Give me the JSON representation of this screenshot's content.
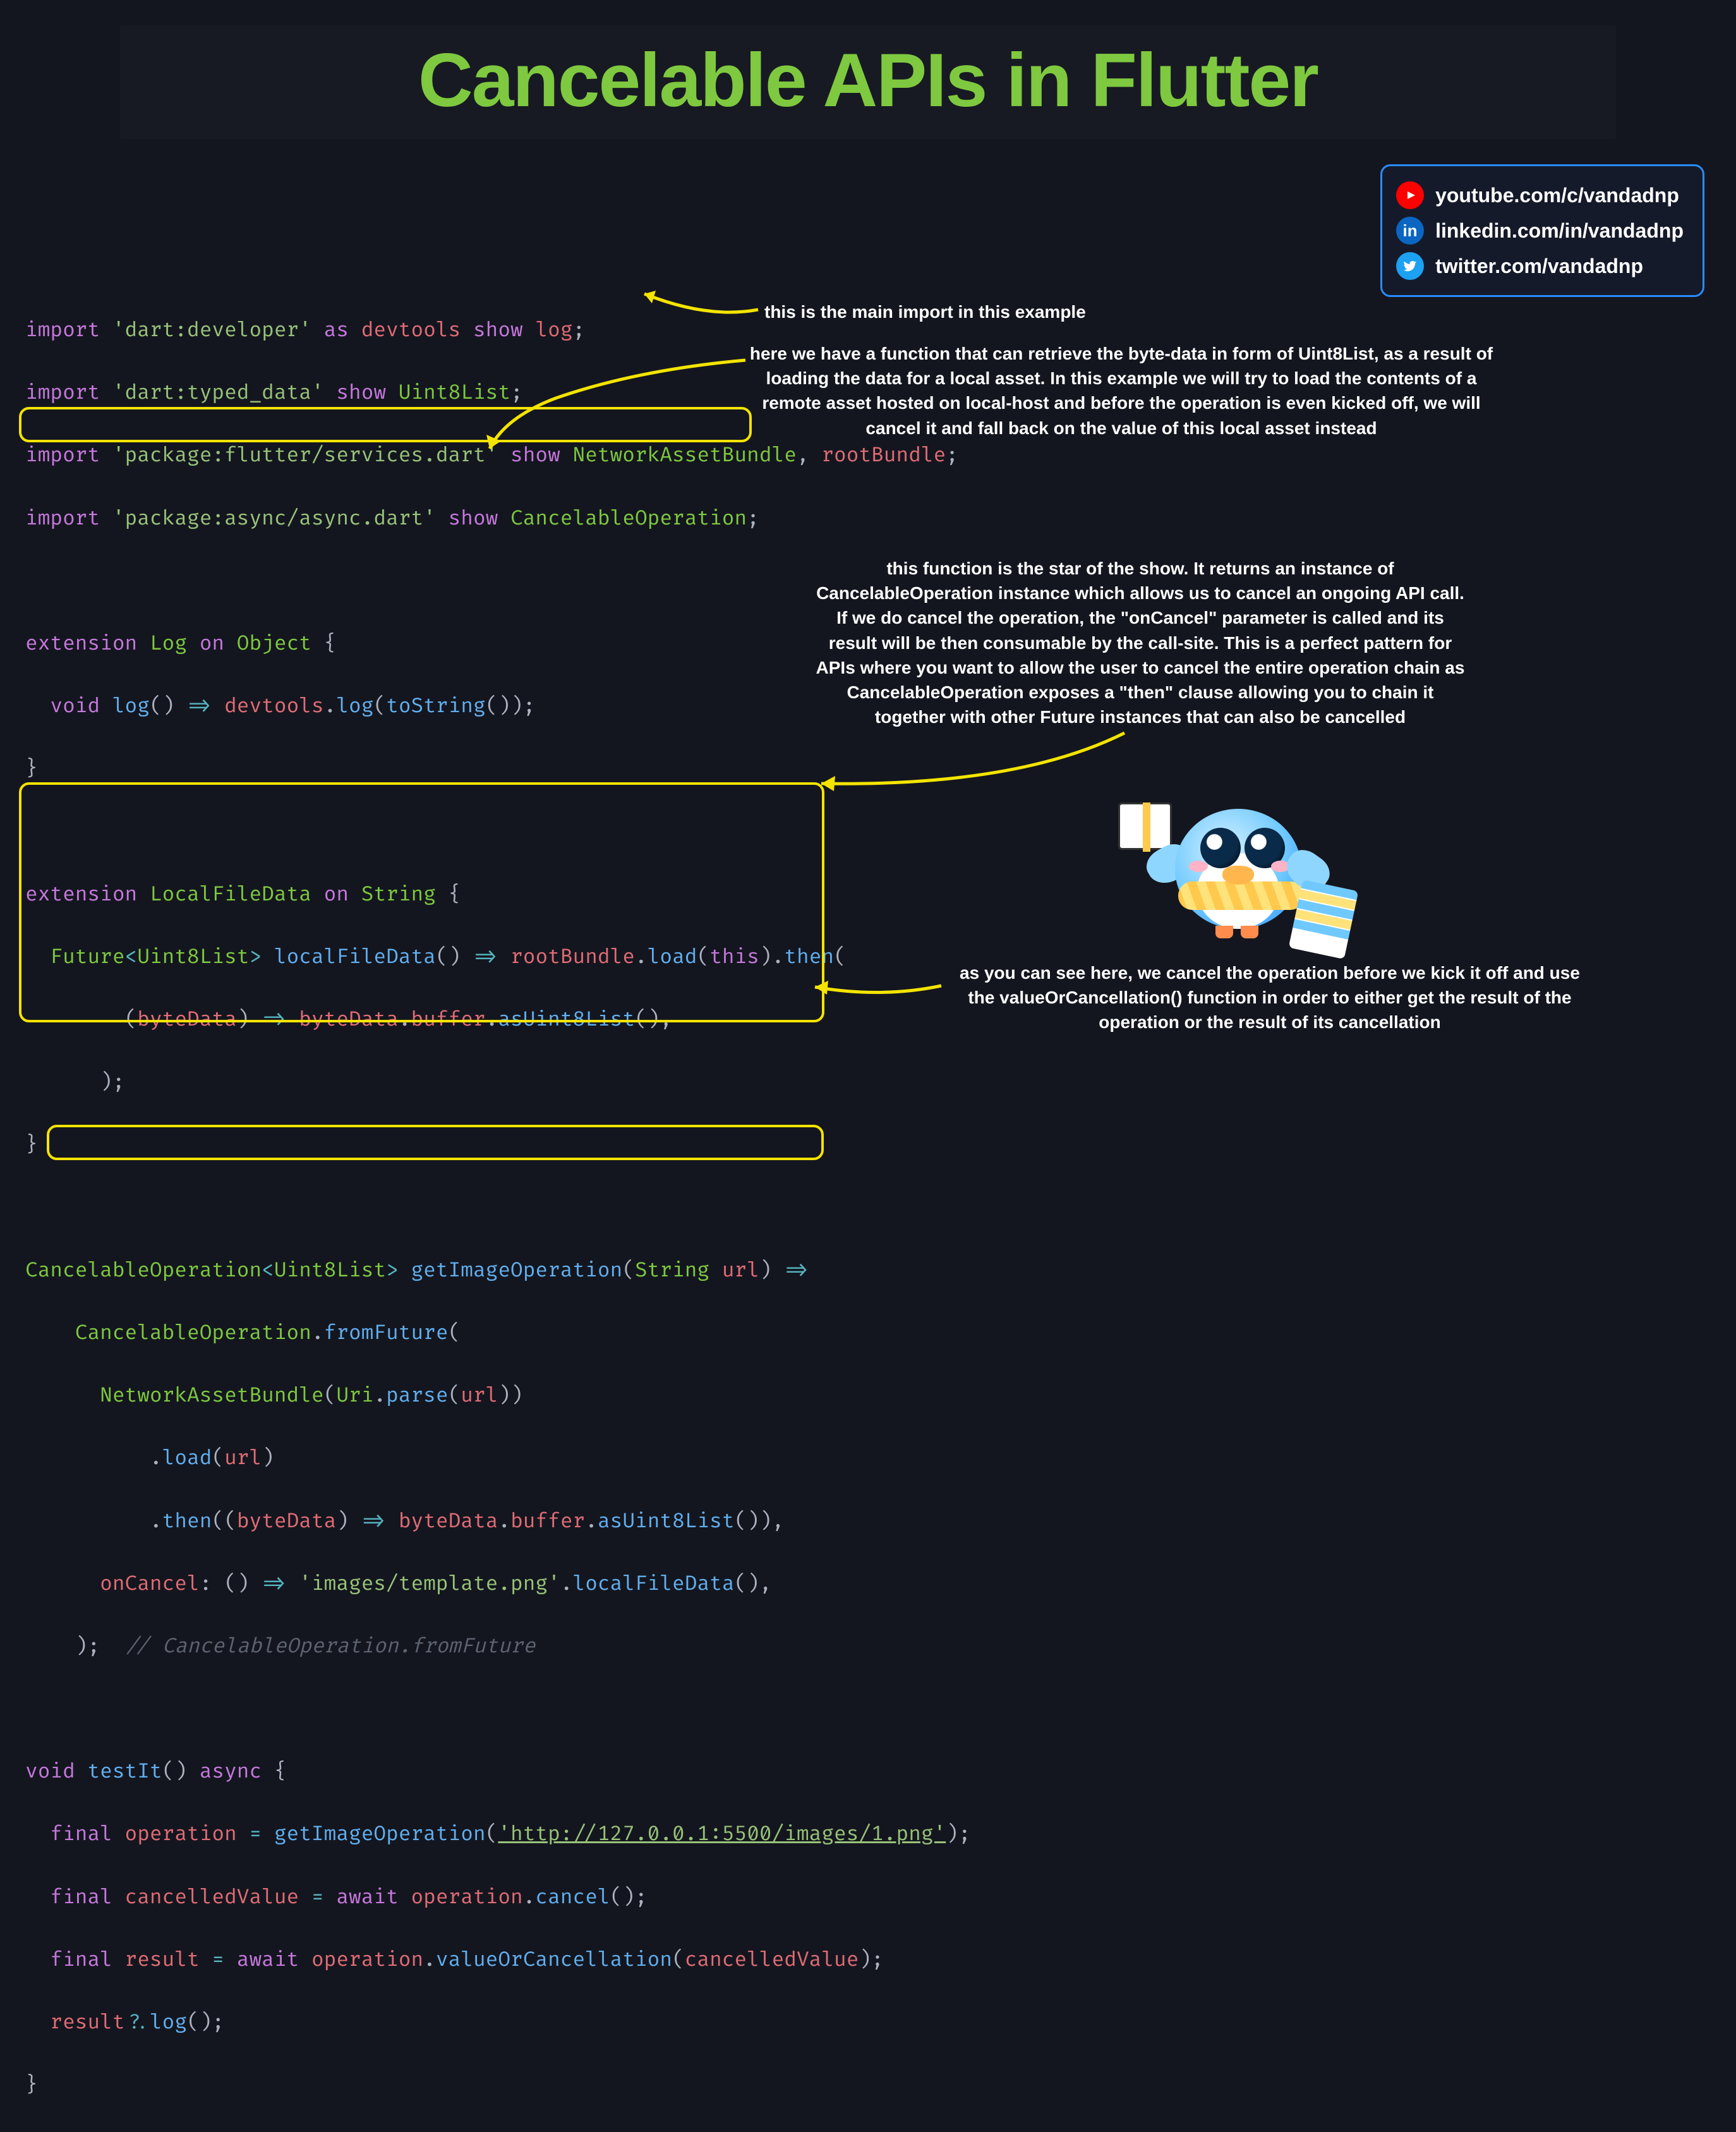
{
  "title": "Cancelable APIs in Flutter",
  "social": {
    "youtube": "youtube.com/c/vandadnp",
    "linkedin": "linkedin.com/in/vandadnp",
    "twitter": "twitter.com/vandadnp"
  },
  "code": {
    "l1": {
      "kw1": "import ",
      "str": "'dart:developer'",
      "kw2": " as ",
      "id": "devtools",
      "kw3": " show ",
      "id2": "log",
      "end": ";"
    },
    "l2": {
      "kw1": "import ",
      "str": "'dart:typed_data'",
      "kw2": " show ",
      "id": "Uint8List",
      "end": ";"
    },
    "l3": {
      "kw1": "import ",
      "str": "'package:flutter/services.dart'",
      "kw2": " show ",
      "id": "NetworkAssetBundle",
      "sep": ", ",
      "id2": "rootBundle",
      "end": ";"
    },
    "l4": {
      "kw1": "import ",
      "str": "'package:async/async.dart'",
      "kw2": " show ",
      "id": "CancelableOperation",
      "end": ";"
    },
    "l6": {
      "kw1": "extension ",
      "cls": "Log",
      "kw2": " on ",
      "typ": "Object",
      "end": " {"
    },
    "l7": {
      "indent": "  ",
      "kw": "void ",
      "fn": "log",
      "p": "()",
      "op": " => ",
      "id": "devtools",
      "dot": ".",
      "fn2": "log",
      "p2": "(",
      "fn3": "toString",
      "p3": "());"
    },
    "l8": "}",
    "l10": {
      "kw1": "extension ",
      "cls": "LocalFileData",
      "kw2": " on ",
      "typ": "String",
      "end": " {"
    },
    "l11": {
      "indent": "  ",
      "typ": "Future",
      "lt": "<",
      "typ2": "Uint8List",
      "gt": "> ",
      "fn": "localFileData",
      "p": "()",
      "op": " => ",
      "id": "rootBundle",
      "dot": ".",
      "fn2": "load",
      "p2": "(",
      "kw": "this",
      "p3": ").",
      "fn3": "then",
      "p4": "("
    },
    "l12": {
      "indent": "        ",
      "p1": "(",
      "id": "byteData",
      "p2": ")",
      "op": " => ",
      "id2": "byteData",
      "dot": ".",
      "id3": "buffer",
      "dot2": ".",
      "fn": "asUint8List",
      "p3": "(),"
    },
    "l13": {
      "indent": "      ",
      "p": ");"
    },
    "l14": "}",
    "l16": {
      "typ": "CancelableOperation",
      "lt": "<",
      "typ2": "Uint8List",
      "gt": "> ",
      "fn": "getImageOperation",
      "p1": "(",
      "typ3": "String",
      "sp": " ",
      "id": "url",
      "p2": ")",
      "op": " =>"
    },
    "l17": {
      "indent": "    ",
      "typ": "CancelableOperation",
      "dot": ".",
      "fn": "fromFuture",
      "p": "("
    },
    "l18": {
      "indent": "      ",
      "typ": "NetworkAssetBundle",
      "p1": "(",
      "typ2": "Uri",
      "dot": ".",
      "fn": "parse",
      "p2": "(",
      "id": "url",
      "p3": "))"
    },
    "l19": {
      "indent": "          ",
      "dot": ".",
      "fn": "load",
      "p1": "(",
      "id": "url",
      "p2": ")"
    },
    "l20": {
      "indent": "          ",
      "dot": ".",
      "fn": "then",
      "p1": "((",
      "id": "byteData",
      "p2": ")",
      "op": " => ",
      "id2": "byteData",
      "dot2": ".",
      "id3": "buffer",
      "dot3": ".",
      "fn2": "asUint8List",
      "p3": "()),"
    },
    "l21": {
      "indent": "      ",
      "id": "onCancel",
      "col": ": ()",
      "op": " => ",
      "str": "'images/template.png'",
      "dot": ".",
      "fn": "localFileData",
      "p": "(),"
    },
    "l22": {
      "indent": "    ",
      "p": ");",
      "cmt": "  // CancelableOperation.fromFuture"
    },
    "l24": {
      "kw": "void ",
      "fn": "testIt",
      "p": "()",
      "kw2": " async ",
      "end": "{"
    },
    "l25": {
      "indent": "  ",
      "kw": "final ",
      "id": "operation",
      "eq": " = ",
      "fn": "getImageOperation",
      "p1": "(",
      "url": "'http://127.0.0.1:5500/images/1.png'",
      "p2": ");"
    },
    "l26": {
      "indent": "  ",
      "kw": "final ",
      "id": "cancelledValue",
      "eq": " = ",
      "kw2": "await ",
      "id2": "operation",
      "dot": ".",
      "fn": "cancel",
      "p": "();"
    },
    "l27": {
      "indent": "  ",
      "kw": "final ",
      "id": "result",
      "eq": " = ",
      "kw2": "await ",
      "id2": "operation",
      "dot": ".",
      "fn": "valueOrCancellation",
      "p1": "(",
      "id3": "cancelledValue",
      "p2": ");"
    },
    "l28": {
      "indent": "  ",
      "id": "result",
      "q": "?.",
      "fn": "log",
      "p": "();"
    },
    "l29": "}"
  },
  "annotations": {
    "a1": "this is the main import in this example",
    "a2": "here we have a function that can retrieve the byte-data in form of Uint8List, as a result of loading the data for a local asset. In this example we will try to load the contents of a remote asset hosted on local-host and before the operation is even kicked off, we will cancel it and fall back on the value of this local asset instead",
    "a3": "this function is the star of the show. It returns an instance of CancelableOperation instance which allows us to cancel an ongoing API call. If we do cancel the operation, the \"onCancel\" parameter is called and its result will be then consumable by the call-site. This is a perfect pattern for APIs where you want to allow the user to cancel the entire operation chain as CancelableOperation exposes a \"then\" clause allowing you to chain it together with other Future instances that can also be cancelled",
    "a4": "as you can see here, we cancel the operation before we kick it off and use the valueOrCancellation() function in order to either get the result of the operation or the result of its cancellation"
  }
}
